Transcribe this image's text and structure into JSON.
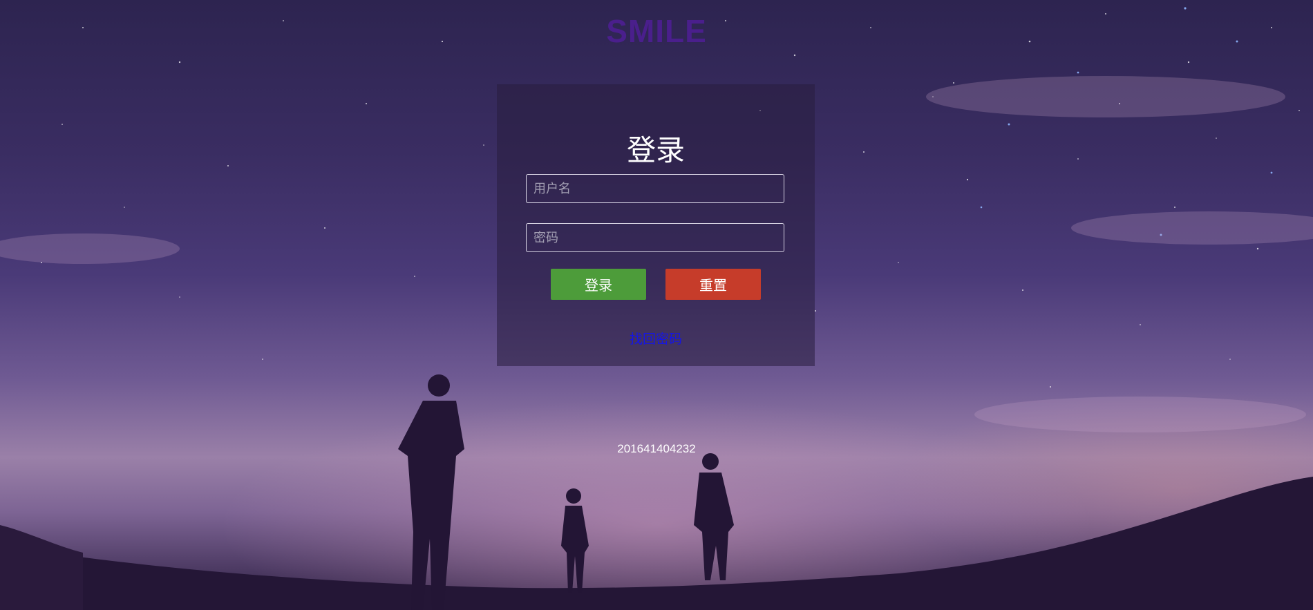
{
  "brand": {
    "title": "SMILE"
  },
  "login": {
    "title": "登录",
    "username": {
      "placeholder": "用户名",
      "value": ""
    },
    "password": {
      "placeholder": "密码",
      "value": ""
    },
    "login_button": "登录",
    "reset_button": "重置",
    "forgot_link": "找回密码"
  },
  "footer": {
    "id_text": "201641404232"
  },
  "colors": {
    "brand": "#4a1f8c",
    "login_button": "#4d9c3a",
    "reset_button": "#c63c2a",
    "link": "#1515e6"
  }
}
